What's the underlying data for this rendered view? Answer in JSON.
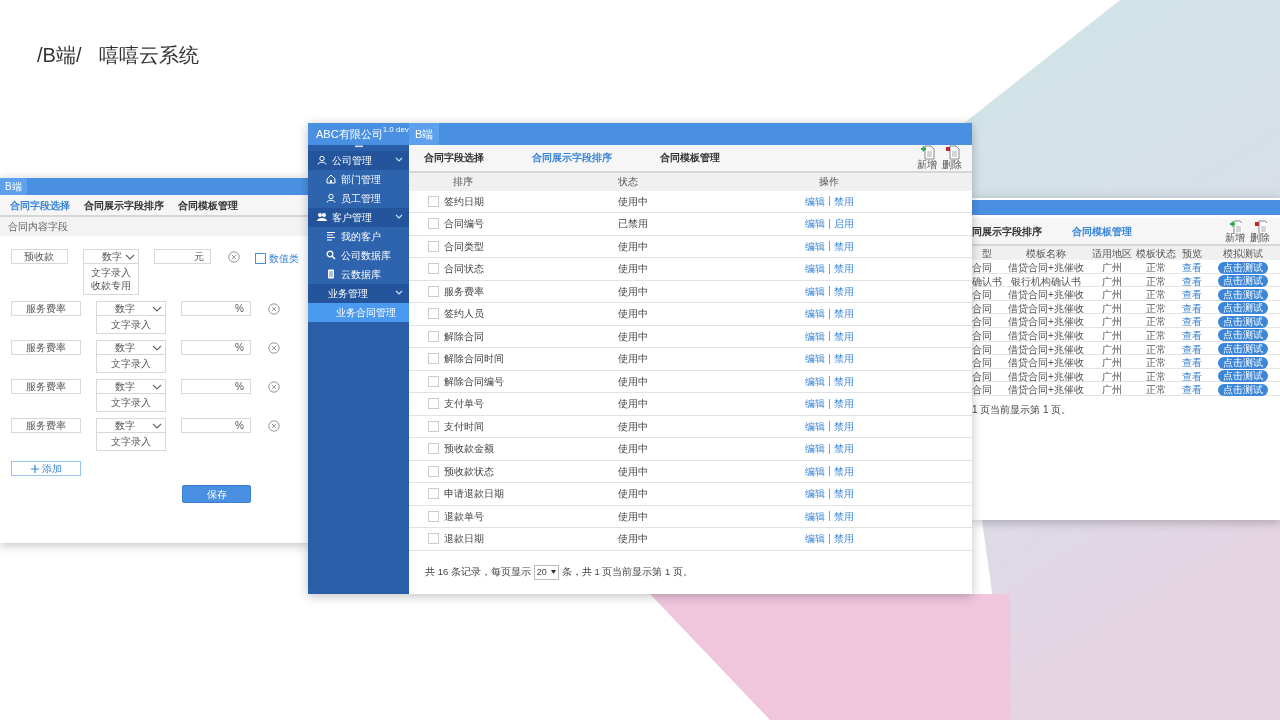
{
  "headline": {
    "path": "/B端/",
    "title": "嘻嘻云系统"
  },
  "left_window": {
    "section": "B端",
    "tabs": [
      {
        "label": "合同字段选择",
        "selected": true
      },
      {
        "label": "合同展示字段排序",
        "selected": false
      },
      {
        "label": "合同模板管理",
        "selected": false
      }
    ],
    "subheader": "合同内容字段",
    "fields": [
      {
        "name": "预收款",
        "type": "数字",
        "options": [
          "文字录入",
          "收款专用"
        ],
        "unit": "元",
        "checkbox": {
          "label": "数值类",
          "checked": false
        }
      },
      {
        "name": "服务费率",
        "type": "数字",
        "options": [
          "文字录入"
        ],
        "unit": "%"
      },
      {
        "name": "服务费率",
        "type": "数字",
        "options": [
          "文字录入"
        ],
        "unit": "%"
      },
      {
        "name": "服务费率",
        "type": "数字",
        "options": [
          "文字录入"
        ],
        "unit": "%"
      },
      {
        "name": "服务费率",
        "type": "数字",
        "options": [
          "文字录入"
        ],
        "unit": "%"
      }
    ],
    "add_button": "添加",
    "save_button": "保存"
  },
  "main_window": {
    "brand": "ABC有限公司$^{1.0 dev}$",
    "section": "B端",
    "sidebar": {
      "groups": [
        {
          "label": "公司管理",
          "expanded": true,
          "children": [
            {
              "label": "部门管理",
              "selected": false
            },
            {
              "label": "员工管理",
              "selected": false
            }
          ]
        },
        {
          "label": "客户管理",
          "expanded": true,
          "children": [
            {
              "label": "我的客户",
              "selected": false
            },
            {
              "label": "公司数据库",
              "selected": false
            },
            {
              "label": "云数据库",
              "selected": false
            }
          ]
        },
        {
          "label": "业务管理",
          "expanded": true,
          "children": [
            {
              "label": "业务合同管理",
              "selected": true
            }
          ]
        }
      ]
    },
    "tabs": [
      {
        "label": "合同字段选择",
        "selected": false
      },
      {
        "label": "合同展示字段排序",
        "selected": true
      },
      {
        "label": "合同模板管理",
        "selected": false
      }
    ],
    "toolbar": [
      {
        "label": "新增",
        "kind": "add"
      },
      {
        "label": "删除",
        "kind": "delete"
      }
    ],
    "table": {
      "columns": [
        "排序",
        "状态",
        "操作"
      ],
      "rows": [
        {
          "name": "签约日期",
          "status": "使用中",
          "actions": [
            "编辑",
            "禁用"
          ],
          "checked": false
        },
        {
          "name": "合同编号",
          "status": "已禁用",
          "actions": [
            "编辑",
            "启用"
          ],
          "checked": false
        },
        {
          "name": "合同类型",
          "status": "使用中",
          "actions": [
            "编辑",
            "禁用"
          ],
          "checked": false
        },
        {
          "name": "合同状态",
          "status": "使用中",
          "actions": [
            "编辑",
            "禁用"
          ],
          "checked": false
        },
        {
          "name": "服务费率",
          "status": "使用中",
          "actions": [
            "编辑",
            "禁用"
          ],
          "checked": false
        },
        {
          "name": "签约人员",
          "status": "使用中",
          "actions": [
            "编辑",
            "禁用"
          ],
          "checked": false
        },
        {
          "name": "解除合同",
          "status": "使用中",
          "actions": [
            "编辑",
            "禁用"
          ],
          "checked": false
        },
        {
          "name": "解除合同时间",
          "status": "使用中",
          "actions": [
            "编辑",
            "禁用"
          ],
          "checked": false
        },
        {
          "name": "解除合同编号",
          "status": "使用中",
          "actions": [
            "编辑",
            "禁用"
          ],
          "checked": false
        },
        {
          "name": "支付单号",
          "status": "使用中",
          "actions": [
            "编辑",
            "禁用"
          ],
          "checked": false
        },
        {
          "name": "支付时间",
          "status": "使用中",
          "actions": [
            "编辑",
            "禁用"
          ],
          "checked": false
        },
        {
          "name": "预收款金额",
          "status": "使用中",
          "actions": [
            "编辑",
            "禁用"
          ],
          "checked": false
        },
        {
          "name": "预收款状态",
          "status": "使用中",
          "actions": [
            "编辑",
            "禁用"
          ],
          "checked": false
        },
        {
          "name": "申请退款日期",
          "status": "使用中",
          "actions": [
            "编辑",
            "禁用"
          ],
          "checked": false
        },
        {
          "name": "退款单号",
          "status": "使用中",
          "actions": [
            "编辑",
            "禁用"
          ],
          "checked": false
        },
        {
          "name": "退款日期",
          "status": "使用中",
          "actions": [
            "编辑",
            "禁用"
          ],
          "checked": false
        }
      ]
    },
    "pagination": {
      "before": "共 16 条记录，每页显示",
      "page_size": "20",
      "after": "条，共 1 页当前显示第 1 页。"
    }
  },
  "right_window": {
    "tabs": [
      {
        "label": "同展示字段排序",
        "selected": false
      },
      {
        "label": "合同模板管理",
        "selected": true
      }
    ],
    "toolbar": [
      {
        "label": "新增",
        "kind": "add"
      },
      {
        "label": "删除",
        "kind": "delete"
      }
    ],
    "table": {
      "columns": [
        "型",
        "模板名称",
        "适用地区",
        "模板状态",
        "预览",
        "模拟测试"
      ],
      "rows": [
        {
          "cells": [
            "合同",
            "借贷合同+兆催收",
            "广州",
            "正常"
          ],
          "link": "查看",
          "button": "点击测试"
        },
        {
          "cells": [
            "确认书",
            "银行机构确认书",
            "广州",
            "正常"
          ],
          "link": "查看",
          "button": "点击测试"
        },
        {
          "cells": [
            "合同",
            "借贷合同+兆催收",
            "广州",
            "正常"
          ],
          "link": "查看",
          "button": "点击测试"
        },
        {
          "cells": [
            "合同",
            "借贷合同+兆催收",
            "广州",
            "正常"
          ],
          "link": "查看",
          "button": "点击测试"
        },
        {
          "cells": [
            "合同",
            "借贷合同+兆催收",
            "广州",
            "正常"
          ],
          "link": "查看",
          "button": "点击测试"
        },
        {
          "cells": [
            "合同",
            "借贷合同+兆催收",
            "广州",
            "正常"
          ],
          "link": "查看",
          "button": "点击测试"
        },
        {
          "cells": [
            "合同",
            "借贷合同+兆催收",
            "广州",
            "正常"
          ],
          "link": "查看",
          "button": "点击测试"
        },
        {
          "cells": [
            "合同",
            "借贷合同+兆催收",
            "广州",
            "正常"
          ],
          "link": "查看",
          "button": "点击测试"
        },
        {
          "cells": [
            "合同",
            "借贷合同+兆催收",
            "广州",
            "正常"
          ],
          "link": "查看",
          "button": "点击测试"
        },
        {
          "cells": [
            "合同",
            "借贷合同+兆催收",
            "广州",
            "正常"
          ],
          "link": "查看",
          "button": "点击测试"
        }
      ]
    },
    "footer": "1 页当前显示第 1 页。"
  }
}
